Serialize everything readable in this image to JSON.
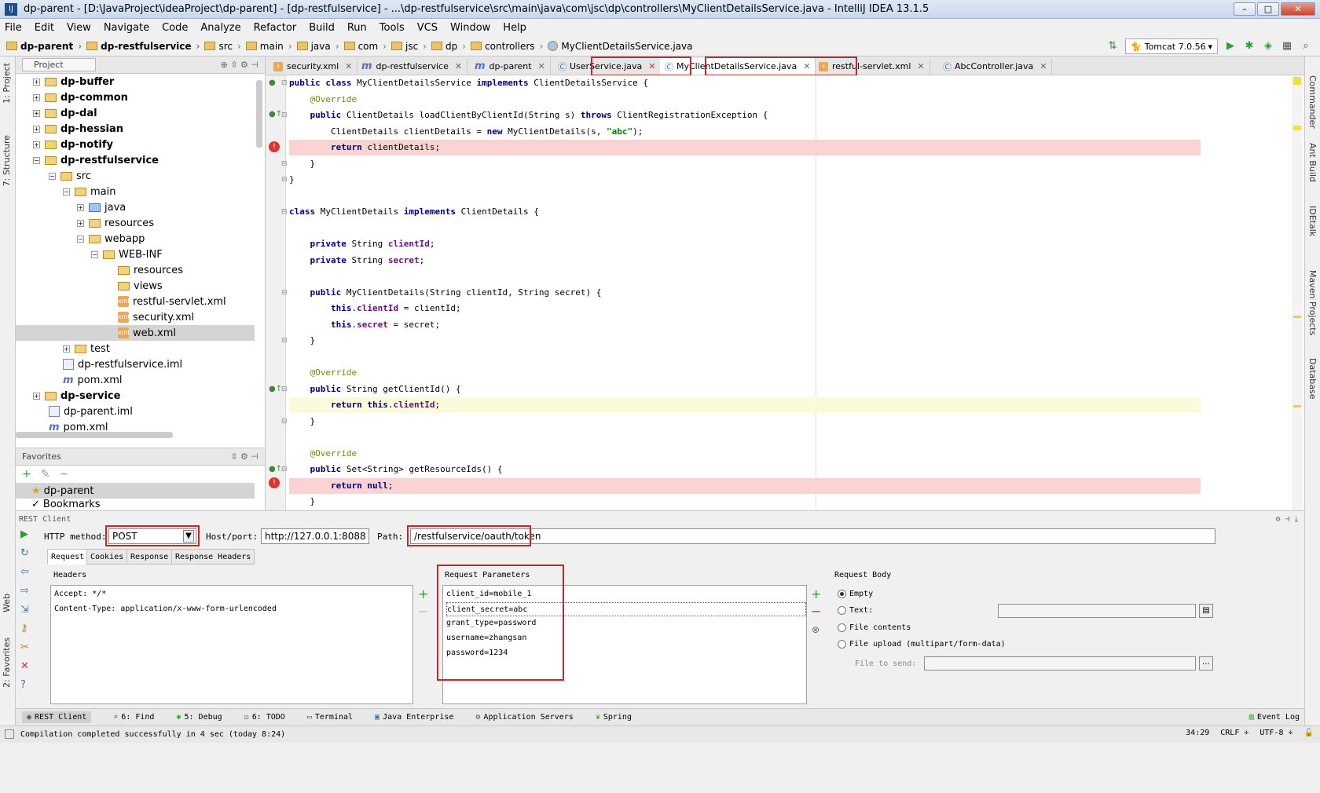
{
  "window": {
    "title": "dp-parent - [D:\\JavaProject\\ideaProject\\dp-parent] - [dp-restfulservice] - ...\\dp-restfulservice\\src\\main\\java\\com\\jsc\\dp\\controllers\\MyClientDetailsService.java - IntelliJ IDEA 13.1.5",
    "min": "–",
    "max": "□",
    "close": "✕"
  },
  "menu": [
    "File",
    "Edit",
    "View",
    "Navigate",
    "Code",
    "Analyze",
    "Refactor",
    "Build",
    "Run",
    "Tools",
    "VCS",
    "Window",
    "Help"
  ],
  "breadcrumbs": [
    "dp-parent",
    "dp-restfulservice",
    "src",
    "main",
    "java",
    "com",
    "jsc",
    "dp",
    "controllers",
    "MyClientDetailsService.java"
  ],
  "run": {
    "config": "Tomcat 7.0.56"
  },
  "left_strip": {
    "project": "1: Project",
    "structure": "7: Structure",
    "web": "Web",
    "favorites": "2: Favorites"
  },
  "right_strip": {
    "commander": "Commander",
    "ant": "Ant Build",
    "idetalk": "IDEtalk",
    "maven": "Maven Projects",
    "database": "Database"
  },
  "project_panel": {
    "title": "Project"
  },
  "tree": [
    {
      "label": "dp-buffer",
      "bold": true
    },
    {
      "label": "dp-common",
      "bold": true
    },
    {
      "label": "dp-dal",
      "bold": true
    },
    {
      "label": "dp-hessian",
      "bold": true
    },
    {
      "label": "dp-notify",
      "bold": true
    },
    {
      "label": "dp-restfulservice",
      "bold": true
    },
    {
      "label": "src"
    },
    {
      "label": "main"
    },
    {
      "label": "java"
    },
    {
      "label": "resources"
    },
    {
      "label": "webapp"
    },
    {
      "label": "WEB-INF"
    },
    {
      "label": "resources"
    },
    {
      "label": "views"
    },
    {
      "label": "restful-servlet.xml"
    },
    {
      "label": "security.xml"
    },
    {
      "label": "web.xml"
    },
    {
      "label": "test"
    },
    {
      "label": "dp-restfulservice.iml"
    },
    {
      "label": "pom.xml"
    },
    {
      "label": "dp-service",
      "bold": true
    },
    {
      "label": "dp-parent.iml"
    },
    {
      "label": "pom.xml"
    }
  ],
  "favorites": {
    "title": "Favorites",
    "items": [
      "dp-parent",
      "Bookmarks"
    ]
  },
  "tabs": [
    {
      "label": "security.xml"
    },
    {
      "label": "dp-restfulservice"
    },
    {
      "label": "dp-parent"
    },
    {
      "label": "UserService.java"
    },
    {
      "label": "MyClientDetailsService.java",
      "active": true
    },
    {
      "label": "restful-servlet.xml"
    },
    {
      "label": "AbcController.java"
    }
  ],
  "code": [
    "public class MyClientDetailsService implements ClientDetailsService {",
    "    @Override",
    "    public ClientDetails loadClientByClientId(String s) throws ClientRegistrationException {",
    "        ClientDetails clientDetails = new MyClientDetails(s, \"abc\");",
    "        return clientDetails;",
    "    }",
    "}",
    "",
    "class MyClientDetails implements ClientDetails {",
    "",
    "    private String clientId;",
    "    private String secret;",
    "",
    "    public MyClientDetails(String clientId, String secret) {",
    "        this.clientId = clientId;",
    "        this.secret = secret;",
    "    }",
    "",
    "    @Override",
    "    public String getClientId() {",
    "        return this.clientId;",
    "    }",
    "",
    "    @Override",
    "    public Set<String> getResourceIds() {",
    "        return null;",
    "    }"
  ],
  "rest": {
    "title": "REST Client",
    "method_label": "HTTP method:",
    "method": "POST",
    "host_label": "Host/port:",
    "host": "http://127.0.0.1:8088",
    "path_label": "Path:",
    "path": "/restfulservice/oauth/token",
    "tabs": [
      "Request",
      "Cookies",
      "Response",
      "Response Headers"
    ],
    "headers_title": "Headers",
    "headers": [
      "Accept: */*",
      "Content-Type: application/x-www-form-urlencoded"
    ],
    "params_title": "Request Parameters",
    "params": [
      "client_id=mobile_1",
      "client_secret=abc",
      "grant_type=password",
      "username=zhangsan",
      "password=1234"
    ],
    "body_title": "Request Body",
    "body_options": [
      "Empty",
      "Text:",
      "File contents",
      "File upload (multipart/form-data)"
    ],
    "file_to_send": "File to send:"
  },
  "bottom_tools": [
    "REST Client",
    "6: Find",
    "5: Debug",
    "6: TODO",
    "Terminal",
    "Java Enterprise",
    "Application Servers",
    "Spring"
  ],
  "event_log": "Event Log",
  "status": {
    "message": "Compilation completed successfully in 4 sec (today 8:24)",
    "position": "34:29",
    "line_sep": "CRLF ÷",
    "encoding": "UTF-8 ÷"
  }
}
